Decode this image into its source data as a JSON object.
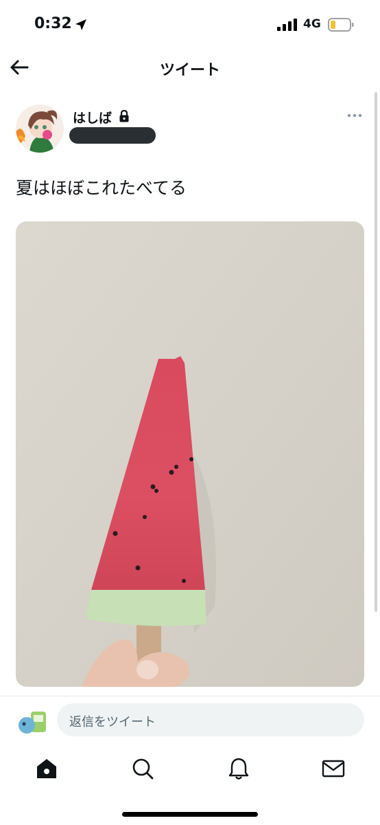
{
  "status_bar": {
    "time": "0:32",
    "network": "4G"
  },
  "nav": {
    "title": "ツイート",
    "back_icon": "arrow-left-icon"
  },
  "tweet": {
    "display_name": "はしば",
    "protected_icon": "lock-icon",
    "text": "夏はほぼこれたべてる",
    "media_description": "photo"
  },
  "reply": {
    "placeholder": "返信をツイート"
  },
  "tabs": [
    {
      "icon": "home-icon"
    },
    {
      "icon": "search-icon"
    },
    {
      "icon": "bell-icon"
    },
    {
      "icon": "mail-icon"
    }
  ],
  "colors": {
    "text": "#0f1419",
    "secondary": "#536471",
    "input_bg": "#eff3f4"
  }
}
